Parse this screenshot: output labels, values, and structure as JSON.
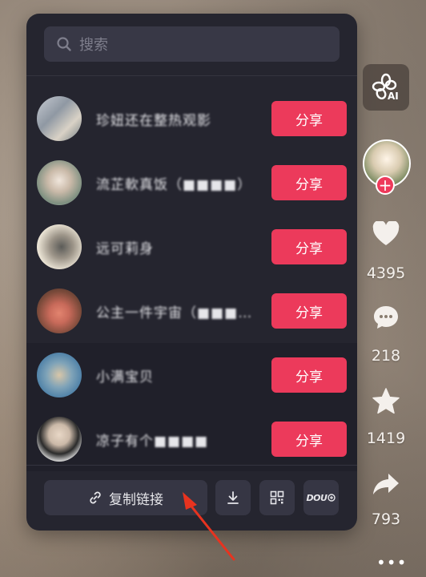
{
  "search": {
    "placeholder": "搜索"
  },
  "contacts": [
    {
      "name": "珍妞还在整热观影",
      "share_label": "分享"
    },
    {
      "name": "流芷軟真饭（■■■■）",
      "share_label": "分享"
    },
    {
      "name": "远可莉身",
      "share_label": "分享"
    },
    {
      "name": "公主一件宇宙（■■■■…",
      "share_label": "分享"
    },
    {
      "name": "小满宝贝",
      "share_label": "分享"
    },
    {
      "name": "凉子有个■■■■",
      "share_label": "分享"
    }
  ],
  "actions": {
    "copy_link_label": "复制链接",
    "dou_label": "DOU"
  },
  "rail": {
    "ai_label": "AI",
    "likes": "4395",
    "comments": "218",
    "favorites": "1419",
    "shares": "793"
  },
  "colors": {
    "accent": "#ec3a5b",
    "panel": "#25252f"
  },
  "icons": [
    "search-icon",
    "link-icon",
    "download-icon",
    "qrcode-icon",
    "heart-icon",
    "comment-icon",
    "star-icon",
    "share-arrow-icon",
    "more-icon"
  ]
}
